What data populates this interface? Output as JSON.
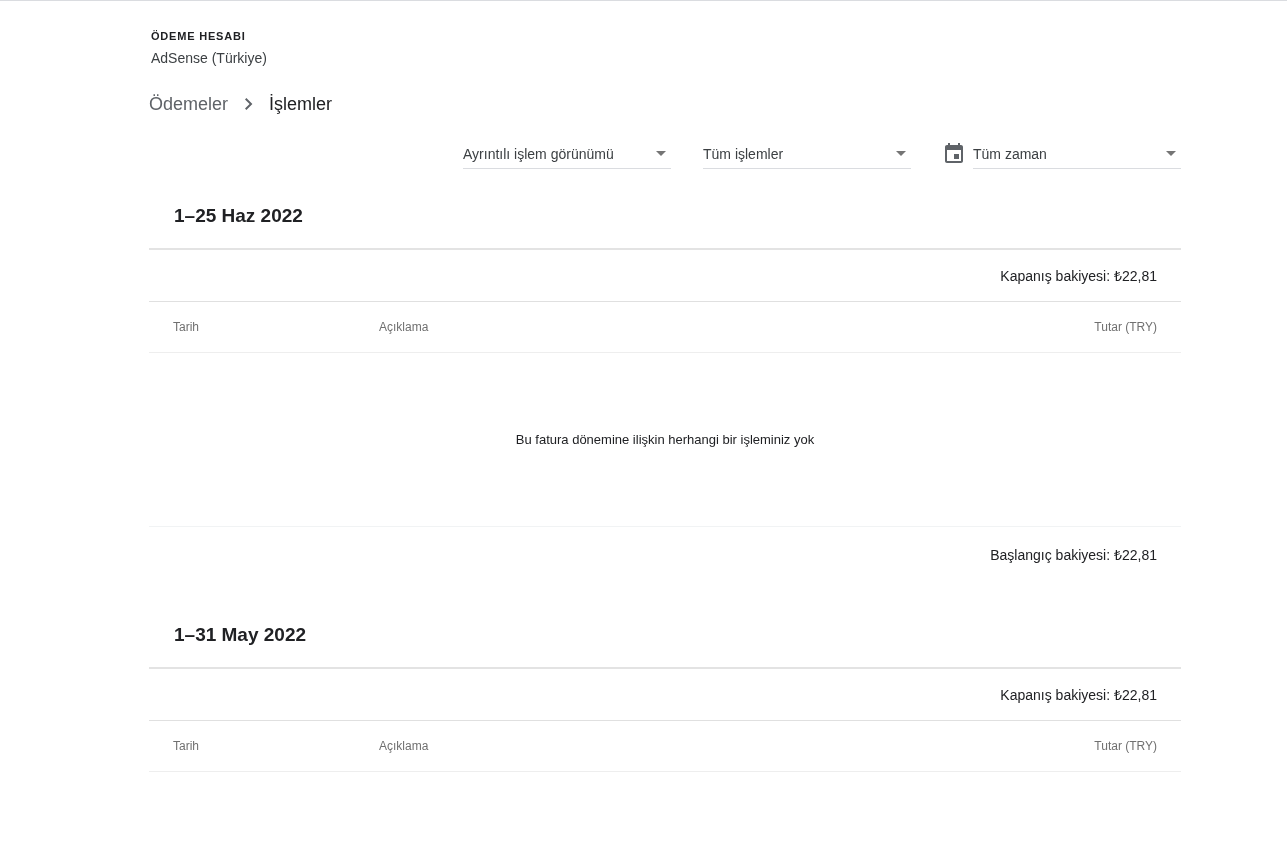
{
  "account": {
    "label": "ÖDEME HESABI",
    "name": "AdSense (Türkiye)"
  },
  "breadcrumb": [
    {
      "label": "Ödemeler",
      "current": false
    },
    {
      "label": "İşlemler",
      "current": true
    }
  ],
  "filters": [
    {
      "kind": "dropdown",
      "value": "Ayrıntılı işlem görünümü"
    },
    {
      "kind": "dropdown",
      "value": "Tüm işlemler"
    },
    {
      "kind": "date",
      "value": "Tüm zaman"
    }
  ],
  "periods": [
    {
      "title": "1–25 Haz 2022",
      "closing_balance": "Kapanış bakiyesi: ₺22,81",
      "columns": [
        "Tarih",
        "Açıklama",
        "Tutar (TRY)"
      ],
      "empty_message": "Bu fatura dönemine ilişkin herhangi bir işleminiz yok",
      "opening_balance": "Başlangıç bakiyesi: ₺22,81"
    },
    {
      "title": "1–31 May 2022",
      "closing_balance": "Kapanış bakiyesi: ₺22,81",
      "columns": [
        "Tarih",
        "Açıklama",
        "Tutar (TRY)"
      ]
    }
  ]
}
